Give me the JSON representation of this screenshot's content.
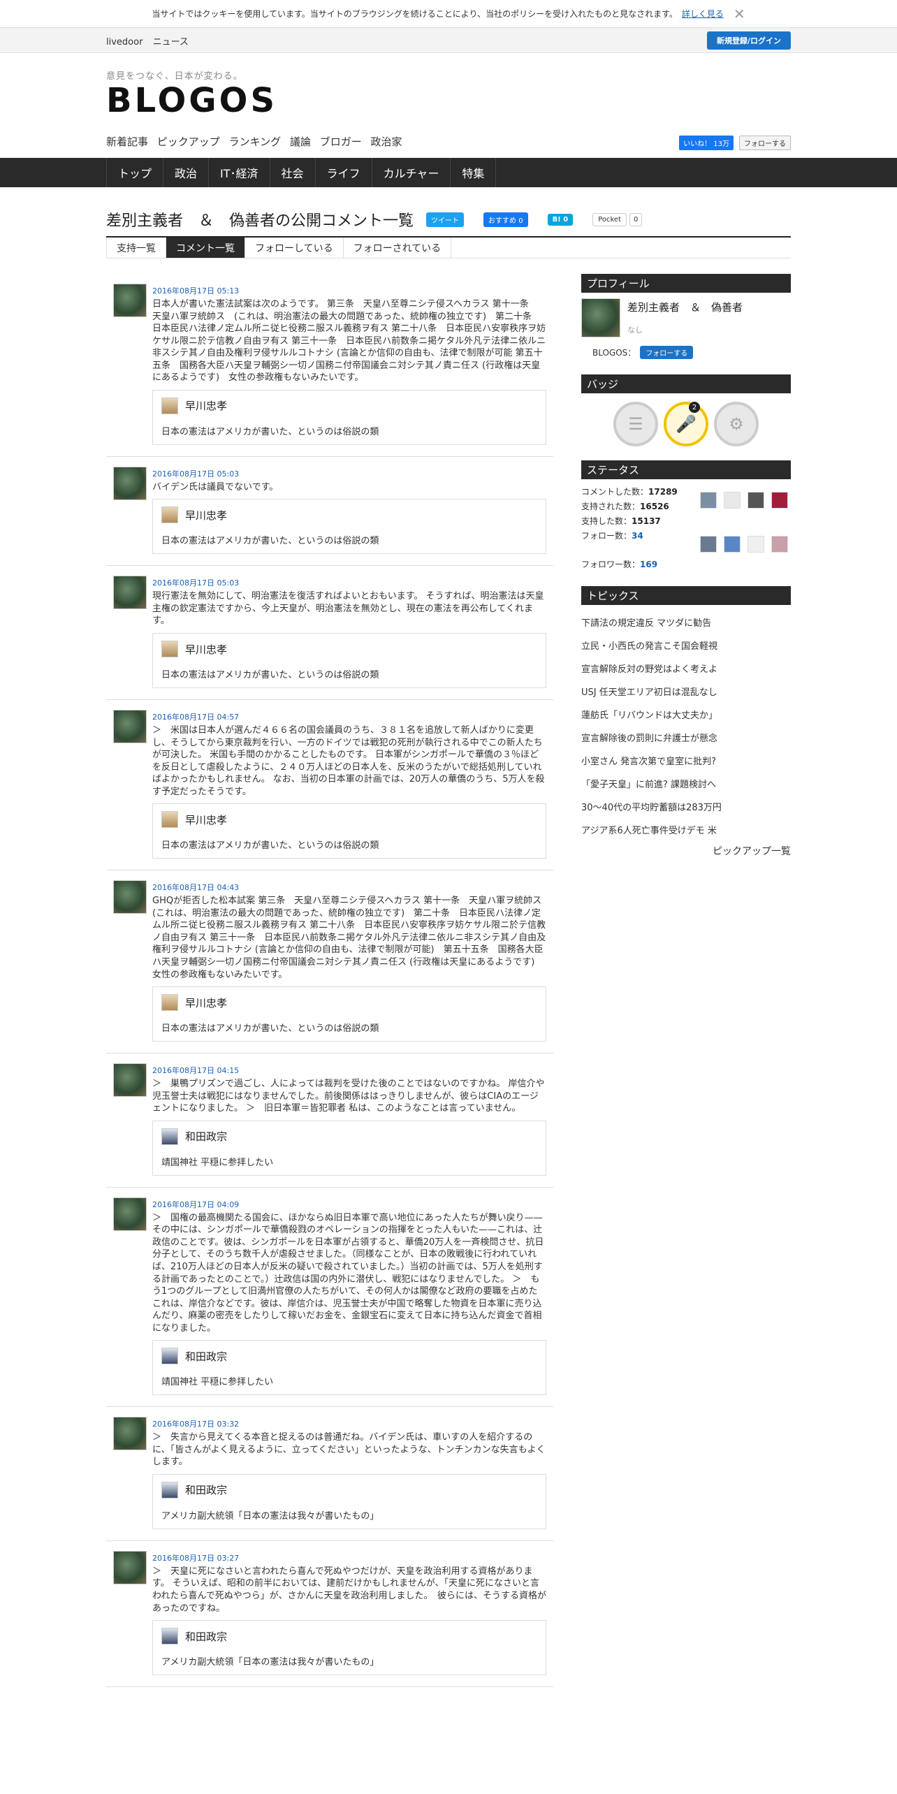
{
  "cookie": {
    "text": "当サイトではクッキーを使用しています。当サイトのブラウジングを続けることにより、当社のポリシーを受け入れたものと見なされます。",
    "link": "詳しく見る",
    "close": "✕"
  },
  "ldbar": {
    "livedoor": "livedoor",
    "news": "ニュース",
    "register": "新規登録/ログイン"
  },
  "header": {
    "tagline": "意見をつなぐ、日本が変わる。",
    "logo": "BLOGOS",
    "subnav": [
      "新着記事",
      "ピックアップ",
      "ランキング",
      "議論",
      "ブロガー",
      "政治家"
    ],
    "fb_like": "いいね！ 13万",
    "tw_follow": "フォローする"
  },
  "mainnav": [
    "トップ",
    "政治",
    "IT･経済",
    "社会",
    "ライフ",
    "カルチャー",
    "特集"
  ],
  "page": {
    "title": "差別主義者　＆　偽善者の公開コメント一覧",
    "share": {
      "tweet": "ツイート",
      "fb": "おすすめ 0",
      "hatena": "B! 0",
      "pocket": "Pocket",
      "pocket_count": "0"
    },
    "tabs": [
      "支持一覧",
      "コメント一覧",
      "フォローしている",
      "フォローされている"
    ]
  },
  "comments": [
    {
      "date": "2016年08月17日 05:13",
      "text": "日本人が書いた憲法試案は次のようです。 第三条　天皇ハ至尊ニシテ侵スヘカラス 第十一条　天皇ハ軍ヲ統帥ス　(これは、明治憲法の最大の問題であった、統帥権の独立です)　第二十条　日本臣民ハ法律ノ定ムル所ニ従ヒ役務ニ服スル義務ヲ有ス 第二十八条　日本臣民ハ安寧秩序ヲ妨ケサル限ニ於テ信教ノ自由ヲ有ス 第三十一条　日本臣民ハ前数条ニ掲ケタル外凡テ法律ニ依ルニ非スシテ其ノ自由及権利ヲ侵サルルコトナシ (言論とか信仰の自由も、法律で制限が可能 第五十五条　国務各大臣ハ天皇ヲ輔弼シ一切ノ国務ニ付帝国議会ニ対シテ其ノ責ニ任ス (行政権は天皇にあるようです)　女性の参政権もないみたいです。",
      "author": "早川忠孝",
      "quote": "日本の憲法はアメリカが書いた、というのは俗説の類"
    },
    {
      "date": "2016年08月17日 05:03",
      "text": "バイデン氏は議員でないです。",
      "author": "早川忠孝",
      "quote": "日本の憲法はアメリカが書いた、というのは俗説の類"
    },
    {
      "date": "2016年08月17日 05:03",
      "text": "現行憲法を無効にして、明治憲法を復活すればよいとおもいます。 そうすれば、明治憲法は天皇主権の欽定憲法ですから、今上天皇が、明治憲法を無効とし、現在の憲法を再公布してくれます。",
      "author": "早川忠孝",
      "quote": "日本の憲法はアメリカが書いた、というのは俗説の類"
    },
    {
      "date": "2016年08月17日 04:57",
      "text": "＞　米国は日本人が選んだ４６６名の国会議員のうち、３８１名を追放して新人ばかりに変更し、そうしてから東京裁判を行い、一方のドイツでは戦犯の死刑が執行される中でこの新人たちが可決した。 米国も手間のかかることしたものです。 日本軍がシンガポールで華僑の３％ほどを反日として虐殺したように、２４０万人ほどの日本人を、反米のうたがいで総括処刑していればよかったかもしれません。 なお、当初の日本軍の計画では、20万人の華僑のうち、5万人を殺す予定だったそうです。",
      "author": "早川忠孝",
      "quote": "日本の憲法はアメリカが書いた、というのは俗説の類"
    },
    {
      "date": "2016年08月17日 04:43",
      "text": "GHQが拒否した松本試案 第三条　天皇ハ至尊ニシテ侵スヘカラス 第十一条　天皇ハ軍ヲ統帥ス　(これは、明治憲法の最大の問題であった、統帥権の独立です)　第二十条　日本臣民ハ法律ノ定ムル所ニ従ヒ役務ニ服スル義務ヲ有ス 第二十八条　日本臣民ハ安寧秩序ヲ妨ケサル限ニ於テ信教ノ自由ヲ有ス 第三十一条　日本臣民ハ前数条ニ掲ケタル外凡テ法律ニ依ルニ非スシテ其ノ自由及権利ヲ侵サルルコトナシ (言論とか信仰の自由も、法律で制限が可能)　第五十五条　国務各大臣ハ天皇ヲ輔弼シ一切ノ国務ニ付帝国議会ニ対シテ其ノ責ニ任ス (行政権は天皇にあるようです)　女性の参政権もないみたいです。",
      "author": "早川忠孝",
      "quote": "日本の憲法はアメリカが書いた、というのは俗説の類"
    },
    {
      "date": "2016年08月17日 04:15",
      "text": "＞　巣鴨プリズンで過ごし、人によっては裁判を受けた後のことではないのですかね。 岸信介や児玉誉士夫は戦犯にはなりませんでした。前後関係ははっきりしませんが、彼らはCIAのエージェントになりました。 ＞　旧日本軍＝皆犯罪者 私は、このようなことは言っていません。",
      "author": "和田政宗",
      "quote": "靖国神社 平穏に参拝したい"
    },
    {
      "date": "2016年08月17日 04:09",
      "text": "＞　国権の最高機関たる国会に、ほかならぬ旧日本軍で高い地位にあった人たちが舞い戻り——その中には、シンガポールで華僑殺戮のオペレーションの指揮をとった人もいた——これは、辻政信のことです。彼は、シンガポールを日本軍が占領すると、華僑20万人を一斉検問させ、抗日分子として、そのうち数千人が虐殺させました。（同様なことが、日本の敗戦後に行われていれば、210万人ほどの日本人が反米の疑いで殺されていました。）当初の計画では、5万人を処刑する計画であったとのことで。）辻政信は国の内外に潜伏し、戦犯にはなりませんでした。 ＞　もう1つのグループとして旧満州官僚の人たちがいて、その何人かは閣僚など政府の要職を占めた これは、岸信介などです。彼は、岸信介は、児玉誉士夫が中国で略奪した物資を日本軍に売り込んだり、麻薬の密売をしたりして稼いだお金を、金銀宝石に変えて日本に持ち込んだ資金で首相になりました。",
      "author": "和田政宗",
      "quote": "靖国神社 平穏に参拝したい"
    },
    {
      "date": "2016年08月17日 03:32",
      "text": "＞　失言から見えてくる本音と捉えるのは普通だね。バイデン氏は、車いすの人を紹介するのに、「皆さんがよく見えるように、立ってください」といったような、トンチンカンな失言もよくします。",
      "author": "和田政宗",
      "quote": "アメリカ副大統領「日本の憲法は我々が書いたもの」"
    },
    {
      "date": "2016年08月17日 03:27",
      "text": "＞　天皇に死になさいと言われたら喜んで死ぬやつだけが、天皇を政治利用する資格があります。 そういえば、昭和の前半においては、建前だけかもしれませんが、「天皇に死になさいと言われたら喜んで死ぬやつら」が、さかんに天皇を政治利用しました。　彼らには、そうする資格があったのですね。",
      "author": "和田政宗",
      "quote": "アメリカ副大統領「日本の憲法は我々が書いたもの」"
    }
  ],
  "sidebar": {
    "profile_head": "プロフィール",
    "name": "差別主義者　＆　偽善者",
    "none": "なし",
    "blogos_label": "BLOGOS：",
    "follow": "フォローする",
    "badge_head": "バッジ",
    "badge_count": "2",
    "status_head": "ステータス",
    "stats": {
      "comments_label": "コメントした数：",
      "comments": "17289",
      "supported_label": "支持された数：",
      "supported": "16526",
      "support_label": "支持した数：",
      "support": "15137",
      "follow_label": "フォロー数：",
      "follow": "34",
      "follower_label": "フォロワー数：",
      "follower": "169"
    },
    "topics_head": "トピックス",
    "topics": [
      "下請法の規定違反 マツダに勧告",
      "立民・小西氏の発言こそ国会軽視",
      "宣言解除反対の野党はよく考えよ",
      "USJ 任天堂エリア初日は混乱なし",
      "蓮舫氏「リバウンドは大丈夫か」",
      "宣言解除後の罰則に弁護士が懸念",
      "小室さん 発言次第で皇室に批判?",
      "「愛子天皇」に前進? 課題検討へ",
      "30～40代の平均貯蓄額は283万円",
      "アジア系6人死亡事件受けデモ 米"
    ],
    "topics_more": "ピックアップ一覧"
  }
}
